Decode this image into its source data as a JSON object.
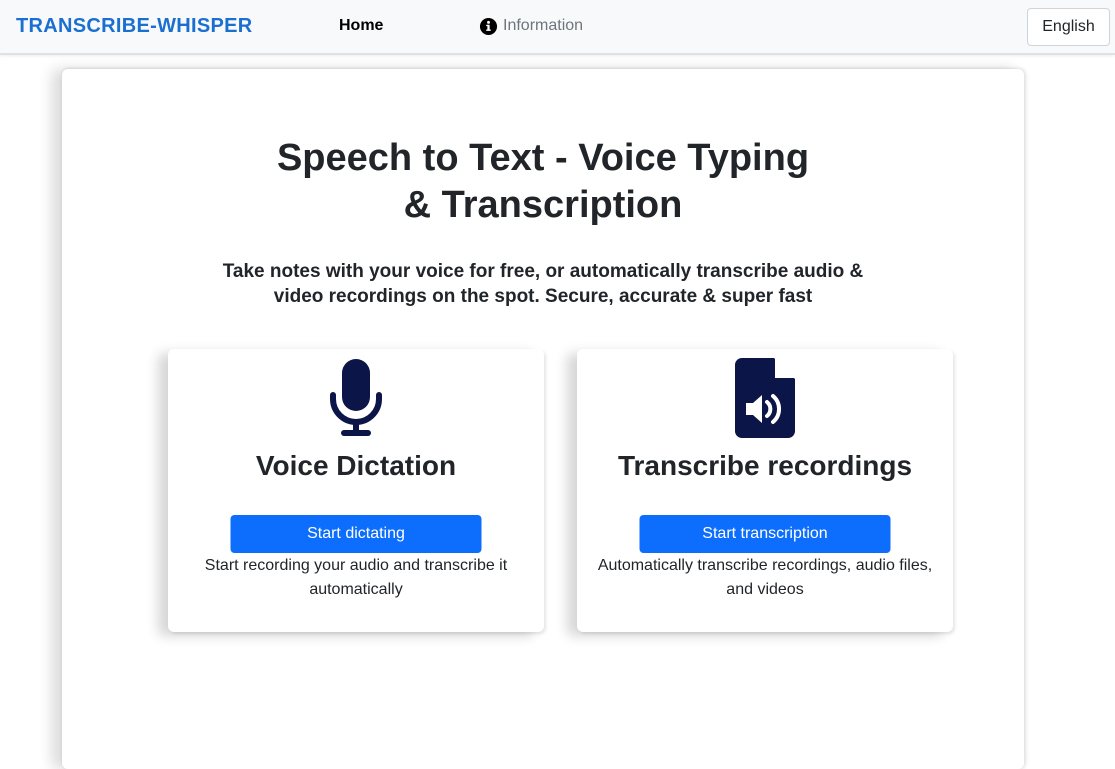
{
  "navbar": {
    "brand": "TRANSCRIBE-WHISPER",
    "home_label": "Home",
    "info_icon": "info-circle-icon",
    "info_label": "Information",
    "language": "English"
  },
  "hero": {
    "title": "Speech to Text - Voice Typing & Transcription",
    "subtitle": "Take notes with your voice for free, or automatically transcribe audio & video recordings on the spot. Secure, accurate & super fast"
  },
  "features": [
    {
      "icon": "microphone-icon",
      "title": "Voice Dictation",
      "button": "Start dictating",
      "description": "Start recording your audio and transcribe it automatically"
    },
    {
      "icon": "audio-file-icon",
      "title": "Transcribe recordings",
      "button": "Start transcription",
      "description": "Automatically transcribe recordings, audio files, and videos"
    }
  ],
  "colors": {
    "brand": "#1a6fd1",
    "primary_button": "#0d6efd",
    "icon_navy": "#0b1547",
    "navbar_bg": "#f8f9fa"
  }
}
